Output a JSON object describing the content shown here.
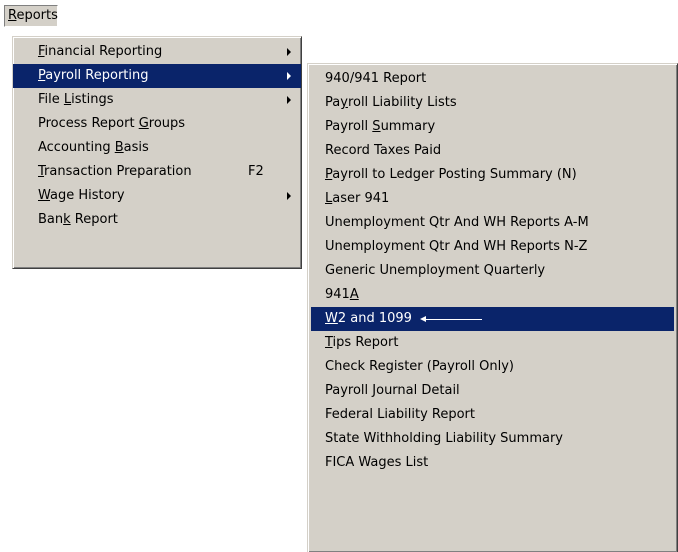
{
  "menubar": {
    "reports": {
      "pre": "",
      "mn": "R",
      "post": "eports"
    }
  },
  "reports_menu": {
    "items": [
      {
        "pre": "",
        "mn": "F",
        "post": "inancial Reporting",
        "submenu": true
      },
      {
        "pre": "",
        "mn": "P",
        "post": "ayroll Reporting",
        "submenu": true,
        "selected": true
      },
      {
        "pre": "File ",
        "mn": "L",
        "post": "istings",
        "submenu": true
      },
      {
        "pre": "Process Report ",
        "mn": "G",
        "post": "roups"
      },
      {
        "pre": "Accounting ",
        "mn": "B",
        "post": "asis"
      },
      {
        "pre": "",
        "mn": "T",
        "post": "ransaction Preparation",
        "shortcut": "F2"
      },
      {
        "pre": "",
        "mn": "W",
        "post": "age History",
        "submenu": true
      },
      {
        "pre": "Ban",
        "mn": "k",
        "post": " Report"
      }
    ]
  },
  "payroll_menu": {
    "items": [
      {
        "pre": "940/941 Report",
        "mn": "",
        "post": ""
      },
      {
        "pre": "Pa",
        "mn": "y",
        "post": "roll Liability Lists"
      },
      {
        "pre": "Payroll ",
        "mn": "S",
        "post": "ummary"
      },
      {
        "pre": "Record Taxes Paid",
        "mn": "",
        "post": ""
      },
      {
        "pre": "",
        "mn": "P",
        "post": "ayroll to Ledger Posting Summary (N)"
      },
      {
        "pre": "",
        "mn": "L",
        "post": "aser 941"
      },
      {
        "pre": "Unemployment Qtr And WH Reports A-M",
        "mn": "",
        "post": ""
      },
      {
        "pre": "Unemployment Qtr And WH Reports N-Z",
        "mn": "",
        "post": ""
      },
      {
        "pre": "Generic Unemployment Quarterly",
        "mn": "",
        "post": ""
      },
      {
        "pre": "941",
        "mn": "A",
        "post": ""
      },
      {
        "pre": "",
        "mn": "W",
        "post": "2 and 1099",
        "selected": true,
        "annotated": true
      },
      {
        "pre": "",
        "mn": "T",
        "post": "ips Report"
      },
      {
        "pre": "Check Register (Payroll Only)",
        "mn": "",
        "post": ""
      },
      {
        "pre": "Payroll Journal Detail",
        "mn": "",
        "post": ""
      },
      {
        "pre": "Federal Liability Report",
        "mn": "",
        "post": ""
      },
      {
        "pre": "State Withholding Liability Summary",
        "mn": "",
        "post": ""
      },
      {
        "pre": "FICA Wages List",
        "mn": "",
        "post": ""
      }
    ]
  },
  "colors": {
    "menu_bg": "#d4d0c8",
    "highlight": "#0a246a",
    "highlight_text": "#ffffff"
  }
}
